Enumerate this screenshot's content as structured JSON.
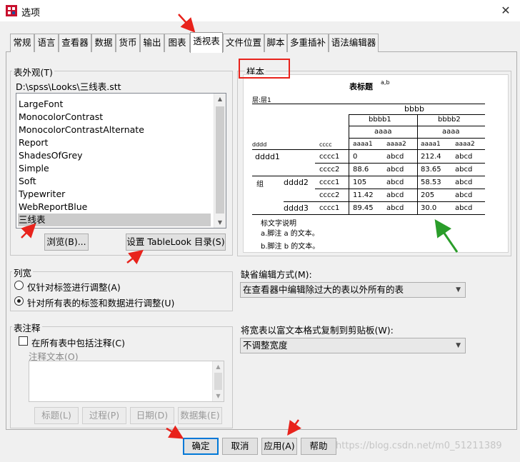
{
  "window": {
    "title": "选项",
    "close_glyph": "✕"
  },
  "tabs": [
    {
      "label": "常规"
    },
    {
      "label": "语言"
    },
    {
      "label": "查看器"
    },
    {
      "label": "数据"
    },
    {
      "label": "货币"
    },
    {
      "label": "输出"
    },
    {
      "label": "图表"
    },
    {
      "label": "透视表"
    },
    {
      "label": "文件位置"
    },
    {
      "label": "脚本"
    },
    {
      "label": "多重插补"
    },
    {
      "label": "语法编辑器"
    }
  ],
  "active_tab": "透视表",
  "table_looks": {
    "label": "表外观(T)",
    "path": "D:\\spss\\Looks\\三线表.stt",
    "items": [
      "LargeFont",
      "MonocolorContrast",
      "MonocolorContrastAlternate",
      "Report",
      "ShadesOfGrey",
      "Simple",
      "Soft",
      "Typewriter",
      "WebReportBlue",
      "三线表"
    ],
    "selected": "三线表",
    "browse_button": "浏览(B)...",
    "set_directory_button": "设置 TableLook 目录(S)"
  },
  "sample": {
    "label": "样本",
    "title": "表标题",
    "title_sup": "a,b",
    "layer": "层:层1",
    "col_top": "bbbb",
    "col_b1": "bbbb1",
    "col_b2": "bbbb2",
    "aaaa": "aaaa",
    "aaaa1": "aaaa1",
    "aaaa2": "aaaa2",
    "row_header_d": "dddd",
    "row_header_c": "cccc",
    "d1": "dddd1",
    "d2": "dddd2",
    "d3": "dddd3",
    "group": "组",
    "cccc1": "cccc1",
    "cccc2": "cccc2",
    "abcd": "abcd",
    "rows": [
      {
        "v1": "0",
        "v2": "212.4"
      },
      {
        "v1": "88.6",
        "v2": "83.65"
      },
      {
        "v1": "105",
        "v2": "58.53"
      },
      {
        "v1": "11.42",
        "v2": "205"
      },
      {
        "v1": "89.45",
        "v2": "30.0"
      }
    ],
    "caption": "标文字说明",
    "footnote_a": "a.脚注 a 的文本。",
    "footnote_b": "b.脚注 b 的文本。"
  },
  "column_widths": {
    "label": "列宽",
    "option1": "仅针对标签进行调整(A)",
    "option2": "针对所有表的标签和数据进行调整(U)",
    "selected": 2
  },
  "comment": {
    "label": "表注释",
    "checkbox": "在所有表中包括注释(C)",
    "checked": false,
    "text_label": "注释文本(O)",
    "buttons": [
      "标题(L)",
      "过程(P)",
      "日期(D)",
      "数据集(E)"
    ]
  },
  "edit_mode": {
    "label": "缺省编辑方式(M):",
    "value": "在查看器中编辑除过大的表以外所有的表"
  },
  "copy_wide": {
    "label": "将宽表以富文本格式复制到剪贴板(W):",
    "value": "不调整宽度"
  },
  "footer": {
    "ok": "确定",
    "cancel": "取消",
    "apply": "应用(A)",
    "help": "帮助"
  },
  "watermark": "https://blog.csdn.net/m0_51211389",
  "colors": {
    "annotation_red": "#e8231c",
    "annotation_green": "#2a9d2a",
    "focus_blue": "#0078d7"
  }
}
